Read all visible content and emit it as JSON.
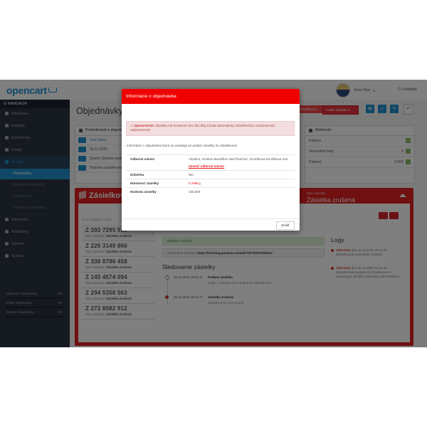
{
  "header": {
    "logo": "opencart",
    "user_name": "John Doe",
    "logout": "Odhlásiť"
  },
  "sidebar": {
    "nav_title": "NAVIGÁCIA",
    "items": [
      {
        "label": "Nástenka"
      },
      {
        "label": "Katalóg"
      },
      {
        "label": "Rozšírenia"
      },
      {
        "label": "Dizajn"
      },
      {
        "label": "Predaj"
      },
      {
        "label": "Zákazníci"
      },
      {
        "label": "Marketing"
      },
      {
        "label": "Systém"
      },
      {
        "label": "Správy"
      }
    ],
    "subitems": [
      "Objednávky",
      "Opakujúce sa profily",
      "Reklamácie",
      "Darčekové poukážky"
    ],
    "stats": [
      {
        "label": "Vybavené objednávky",
        "pct": "0%"
      },
      {
        "label": "Prijaté objednávky",
        "pct": "0%"
      },
      {
        "label": "Ostatné objednávky",
        "pct": "0%"
      }
    ]
  },
  "main": {
    "title": "Objednávky",
    "toolbar_packeta": "Zásielkovňa",
    "toolbar_select": "Podať zásielku",
    "order_panel_title": "Podrobnosti o objednávke",
    "order_rows": [
      "Your Store",
      "30.12.2020",
      "Quatro Spôsob platby",
      "Doprava zásielkovňou"
    ],
    "options_title": "Možnosti",
    "options_rows": [
      {
        "label": "Faktúra",
        "value": ""
      },
      {
        "label": "Vernostné body",
        "value": "0"
      },
      {
        "label": "Partneri",
        "value": "0,00€"
      }
    ]
  },
  "packeta": {
    "brand": "Zásielkovňa",
    "state_label": "Stav zásielky",
    "state": "Zásielka zrušená",
    "list_filter": "Číslo zásielky / Číslo",
    "packages": [
      {
        "number": "Z 393 7295 510",
        "status_label": "Stav zásielky:",
        "status": "Zásielka zrušená"
      },
      {
        "number": "Z 226 3149 866",
        "status_label": "Stav zásielky:",
        "status": "Zásielka zrušená"
      },
      {
        "number": "Z 338 8786 458",
        "status_label": "Stav zásielky:",
        "status": "Zásielka zrušená"
      },
      {
        "number": "Z 145 4574 094",
        "status_label": "Stav zásielky:",
        "status": "Zásielka zrušená"
      },
      {
        "number": "Z 294 5358 563",
        "status_label": "Stav zásielky:",
        "status": "Zásielka zrušená"
      },
      {
        "number": "Z 273 8582 912",
        "status_label": "Stav zásielky:",
        "status": "Zásielka zrušená"
      }
    ],
    "success_alert": "Zásielka zrušená",
    "tracking_prefix": "Sledovanie zásielky:",
    "tracking_url": "https://tracking.packeta.com/sk/?id=Z3937295510",
    "tracking_title": "Sledovanie zásielky",
    "timeline": [
      {
        "date": "30.12.2020 19:41:17",
        "title": "Podaná zásielka",
        "desc": "Údaje o zásielke boli zadané do Zásielkovne."
      },
      {
        "date": "30.12.2020 19:41:27",
        "title": "Zásielka zrušená",
        "desc": "Zásielka bola stornovaná."
      }
    ],
    "logs_title": "Logy",
    "logs": [
      {
        "who": "John Doe",
        "when": "dňa 30.12.2020 19:41:25",
        "text": "Zásielka bola manuálne zrušená."
      },
      {
        "who": "John Doe",
        "when": "dňa 30.12.2020 19:41:16",
        "text": "Zásielka bola podaná do Zásielkovne s menuálnym (ZA2EN 2ásielky) Z3937295510."
      }
    ]
  },
  "modal": {
    "title": "Informácie o objednávke",
    "warning_bold": "Upozornenie:",
    "warning_text": " Zásielka má hmotnosť viac ako 5kg a bude automaticky Zásielkovňou označená ako nadrozmerná!",
    "intro": "Informácie o objednávke ktoré sa zasielajú pri podaní zásielky do Zásielkovne.",
    "rows": [
      {
        "key": "Odberné miesto",
        "value": "Alzabox, Alzabox Beneškov nad Ploučnicí, Dvořákova Dvořákova 434",
        "link": "Zmeniť odberné miesto"
      },
      {
        "key": "Dobierka",
        "value": "Nie"
      },
      {
        "key": "Hmotnosť zásielky",
        "value": "5.299Kg"
      },
      {
        "key": "Hodnota zásielky",
        "value": "100,50€"
      }
    ],
    "close_label": "Zrušiť"
  },
  "colors": {
    "accent": "#1e91cf",
    "packeta_red": "#e02020",
    "modal_header": "#f10000"
  }
}
